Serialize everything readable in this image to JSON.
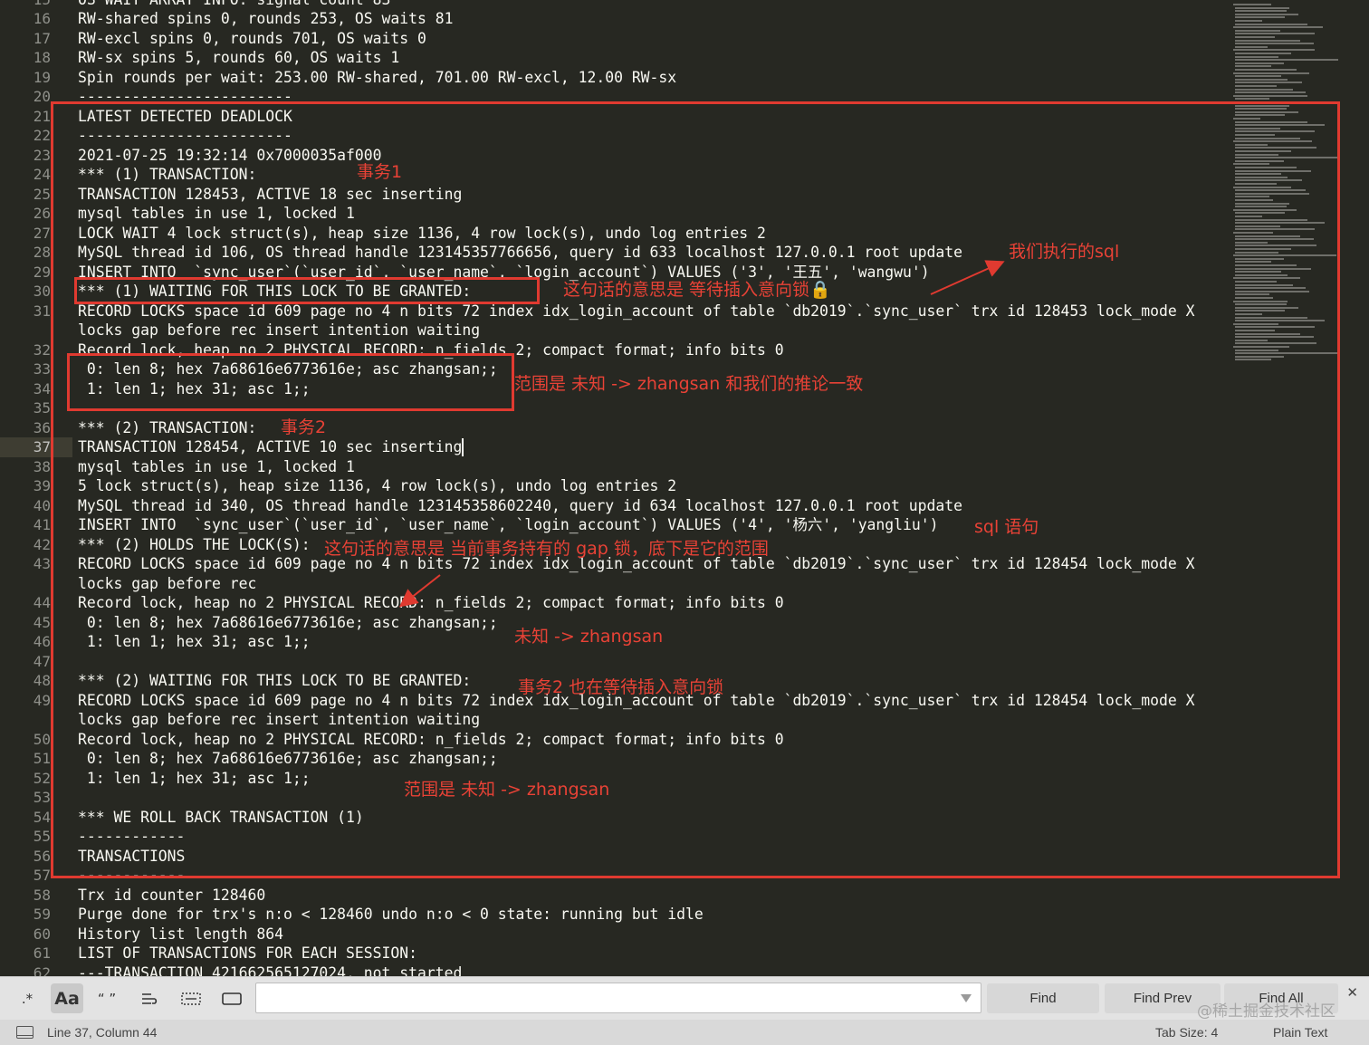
{
  "editor": {
    "line_numbers": [
      "15",
      "16",
      "17",
      "18",
      "19",
      "20",
      "21",
      "22",
      "23",
      "24",
      "25",
      "26",
      "27",
      "28",
      "29",
      "30",
      "31",
      "",
      "32",
      "33",
      "34",
      "35",
      "36",
      "37",
      "38",
      "39",
      "40",
      "41",
      "42",
      "43",
      "",
      "44",
      "45",
      "46",
      "47",
      "48",
      "49",
      "",
      "50",
      "51",
      "52",
      "53",
      "54",
      "55",
      "56",
      "57",
      "58",
      "59",
      "60",
      "61",
      "62"
    ],
    "active_line": "37",
    "rows": [
      "OS WAIT ARRAY INFO: signal count 83",
      "RW-shared spins 0, rounds 253, OS waits 81",
      "RW-excl spins 0, rounds 701, OS waits 0",
      "RW-sx spins 5, rounds 60, OS waits 1",
      "Spin rounds per wait: 253.00 RW-shared, 701.00 RW-excl, 12.00 RW-sx",
      "------------------------",
      "LATEST DETECTED DEADLOCK",
      "------------------------",
      "2021-07-25 19:32:14 0x7000035af000",
      "*** (1) TRANSACTION:",
      "TRANSACTION 128453, ACTIVE 18 sec inserting",
      "mysql tables in use 1, locked 1",
      "LOCK WAIT 4 lock struct(s), heap size 1136, 4 row lock(s), undo log entries 2",
      "MySQL thread id 106, OS thread handle 123145357766656, query id 633 localhost 127.0.0.1 root update",
      "INSERT INTO  `sync_user`(`user_id`, `user_name`, `login_account`) VALUES ('3', '王五', 'wangwu')",
      "*** (1) WAITING FOR THIS LOCK TO BE GRANTED:",
      "RECORD LOCKS space id 609 page no 4 n bits 72 index idx_login_account of table `db2019`.`sync_user` trx id 128453 lock_mode X",
      "locks gap before rec insert intention waiting",
      "Record lock, heap no 2 PHYSICAL RECORD: n_fields 2; compact format; info bits 0",
      " 0: len 8; hex 7a68616e6773616e; asc zhangsan;;",
      " 1: len 1; hex 31; asc 1;;",
      "",
      "*** (2) TRANSACTION:",
      "TRANSACTION 128454, ACTIVE 10 sec inserting",
      "mysql tables in use 1, locked 1",
      "5 lock struct(s), heap size 1136, 4 row lock(s), undo log entries 2",
      "MySQL thread id 340, OS thread handle 123145358602240, query id 634 localhost 127.0.0.1 root update",
      "INSERT INTO  `sync_user`(`user_id`, `user_name`, `login_account`) VALUES ('4', '杨六', 'yangliu')",
      "*** (2) HOLDS THE LOCK(S):",
      "RECORD LOCKS space id 609 page no 4 n bits 72 index idx_login_account of table `db2019`.`sync_user` trx id 128454 lock_mode X",
      "locks gap before rec",
      "Record lock, heap no 2 PHYSICAL RECORD: n_fields 2; compact format; info bits 0",
      " 0: len 8; hex 7a68616e6773616e; asc zhangsan;;",
      " 1: len 1; hex 31; asc 1;;",
      "",
      "*** (2) WAITING FOR THIS LOCK TO BE GRANTED:",
      "RECORD LOCKS space id 609 page no 4 n bits 72 index idx_login_account of table `db2019`.`sync_user` trx id 128454 lock_mode X",
      "locks gap before rec insert intention waiting",
      "Record lock, heap no 2 PHYSICAL RECORD: n_fields 2; compact format; info bits 0",
      " 0: len 8; hex 7a68616e6773616e; asc zhangsan;;",
      " 1: len 1; hex 31; asc 1;;",
      "",
      "*** WE ROLL BACK TRANSACTION (1)",
      "------------",
      "TRANSACTIONS",
      "------------",
      "Trx id counter 128460",
      "Purge done for trx's n:o < 128460 undo n:o < 0 state: running but idle",
      "History list length 864",
      "LIST OF TRANSACTIONS FOR EACH SESSION:",
      "---TRANSACTION 421662565127024, not started"
    ]
  },
  "annotations": {
    "tx1": "事务1",
    "our_sql": "我们执行的sql",
    "wait_insert_intention": "这句话的意思是 等待插入意向锁🔒",
    "range1": "范围是 未知 -> zhangsan 和我们的推论一致",
    "tx2": "事务2",
    "sql_stmt": "sql 语句",
    "holds_gap": "这句话的意思是 当前事务持有的 gap 锁，底下是它的范围",
    "range2": "未知 -> zhangsan",
    "tx2_waiting": "事务2 也在等待插入意向锁",
    "range3": "范围是 未知 -> zhangsan",
    "color": "#e84236"
  },
  "find_panel": {
    "regex_label": ".*",
    "case_label": "Aa",
    "word_label": "“ ”",
    "find_button": "Find",
    "find_prev_button": "Find Prev",
    "find_all_button": "Find All",
    "search_value": "",
    "close_label": "✕"
  },
  "status_bar": {
    "position": "Line 37, Column 44",
    "tab_size": "Tab Size: 4",
    "syntax": "Plain Text"
  },
  "watermark": "@稀土掘金技术社区",
  "theme": {
    "background": "#272822",
    "text": "#f8f8f2",
    "line_number": "#8f908a",
    "annotation_red": "#e03a30"
  }
}
